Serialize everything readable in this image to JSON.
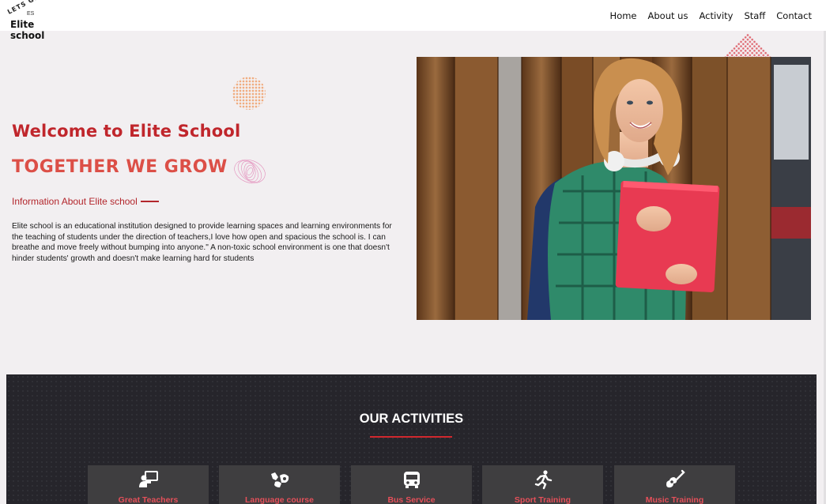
{
  "navbar": {
    "logo_arc_text": "LETS GROW",
    "logo_mark": "ES",
    "logo_name": "Elite school",
    "links": [
      "Home",
      "About us",
      "Activity",
      "Staff",
      "Contact"
    ]
  },
  "hero": {
    "welcome": "Welcome to Elite School",
    "tagline": "TOGETHER WE GROW",
    "info_heading": "Information About Elite school",
    "description": "Elite school is an educational institution designed to provide learning spaces and learning environments for the teaching of students under the direction of teachers,I love how open and spacious the school is. I can breathe and move freely without bumping into anyone.\" A non-toxic school environment is one that doesn't hinder students' growth and doesn't make learning hard for students"
  },
  "activities": {
    "title": "OUR ACTIVITIES",
    "cards": [
      {
        "label": "Great Teachers",
        "icon": "teacher-icon"
      },
      {
        "label": "Language course",
        "icon": "sign-language-icon"
      },
      {
        "label": "Bus Service",
        "icon": "bus-icon"
      },
      {
        "label": "Sport Training",
        "icon": "running-icon"
      },
      {
        "label": "Music Training",
        "icon": "guitar-icon"
      }
    ]
  },
  "colors": {
    "accent_red": "#c0262c",
    "tagline_red": "#dc4f47",
    "activities_bg": "#26252b",
    "card_bg": "#3f3e40"
  }
}
